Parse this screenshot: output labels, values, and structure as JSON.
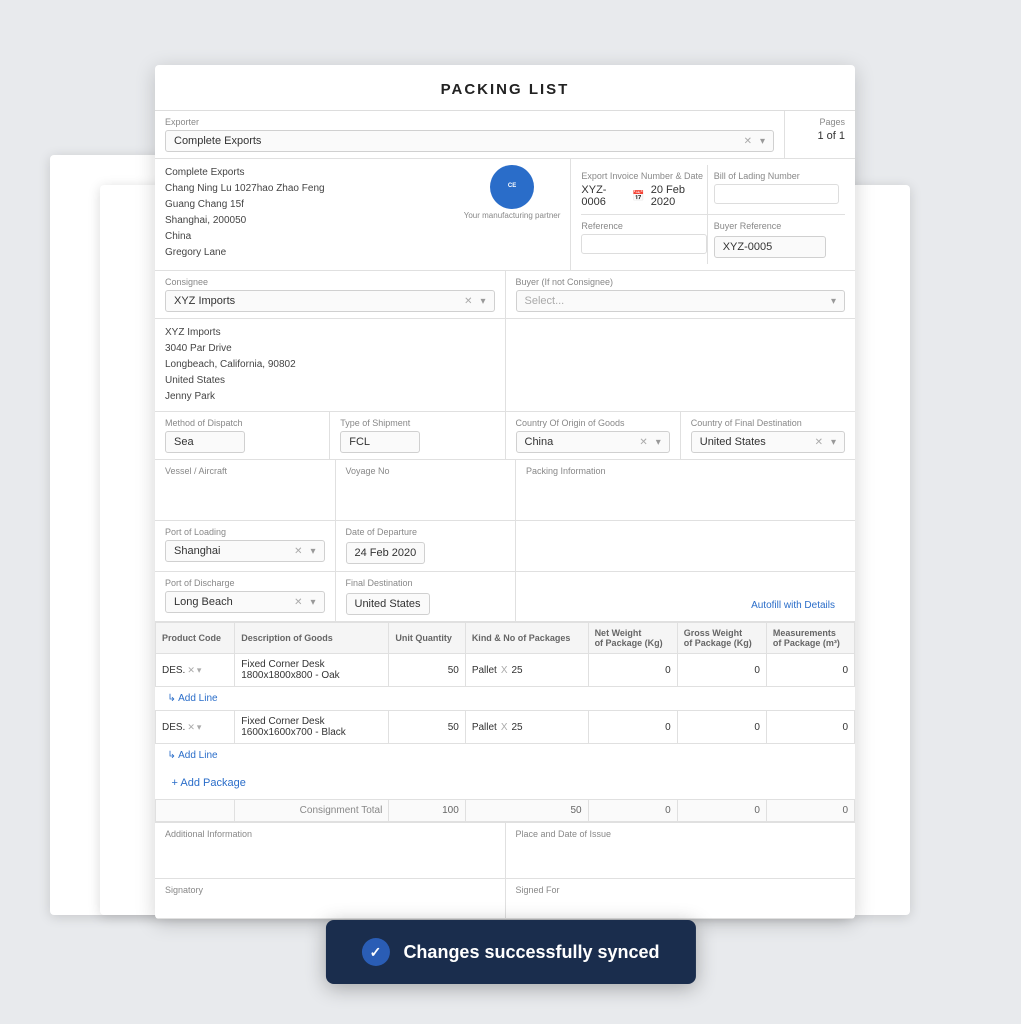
{
  "document": {
    "title": "PACKING LIST",
    "pages_label": "Pages",
    "pages_value": "1 of 1"
  },
  "exporter_section": {
    "label": "Exporter",
    "company": "Complete Exports",
    "address_line1": "Chang Ning Lu 1027hao Zhao Feng",
    "address_line2": "Guang Chang 15f",
    "address_line3": "Shanghai,  200050",
    "address_line4": "China",
    "contact": "Gregory Lane",
    "logo_text": "Complete Exports",
    "logo_tagline": "Your manufacturing partner"
  },
  "invoice_section": {
    "label": "Export Invoice Number & Date",
    "number": "XYZ-0006",
    "date": "20 Feb 2020",
    "bol_label": "Bill of Lading Number"
  },
  "reference_section": {
    "label": "Reference",
    "buyer_ref_label": "Buyer Reference",
    "buyer_ref_value": "XYZ-0005"
  },
  "consignee_section": {
    "label": "Consignee",
    "company": "XYZ Imports",
    "address_line1": "XYZ Imports",
    "address_line2": "3040  Par Drive",
    "address_line3": "Longbeach, California, 90802",
    "address_line4": "United States",
    "contact": "Jenny Park"
  },
  "buyer_section": {
    "label": "Buyer (If not Consignee)",
    "placeholder": "Select..."
  },
  "dispatch_section": {
    "method_label": "Method of Dispatch",
    "method_value": "Sea",
    "shipment_label": "Type of Shipment",
    "shipment_value": "FCL",
    "origin_label": "Country Of Origin of Goods",
    "origin_value": "China",
    "destination_label": "Country of Final Destination",
    "destination_value": "United States"
  },
  "vessel_section": {
    "vessel_label": "Vessel / Aircraft",
    "voyage_label": "Voyage No",
    "packing_label": "Packing Information"
  },
  "port_section": {
    "loading_label": "Port of Loading",
    "loading_value": "Shanghai",
    "departure_label": "Date of Departure",
    "departure_value": "24 Feb 2020",
    "discharge_label": "Port of Discharge",
    "discharge_value": "Long Beach",
    "final_label": "Final Destination",
    "final_value": "United States",
    "autofill_label": "Autofill with Details"
  },
  "table": {
    "headers": [
      "Product Code",
      "Description of Goods",
      "Unit Quantity",
      "Kind & No of Packages",
      "Net Weight of Package (Kg)",
      "Gross Weight of Package (Kg)",
      "Measurements of Package (m³)"
    ],
    "rows": [
      {
        "code": "DES.",
        "description": "Fixed Corner Desk\n1800x1800x800 - Oak",
        "quantity": "50",
        "kind": "Pallet",
        "packages": "25",
        "net_weight": "0",
        "gross_weight": "0",
        "measurements": "0"
      },
      {
        "code": "DES.",
        "description": "Fixed Corner Desk\n1600x1600x700 - Black",
        "quantity": "50",
        "kind": "Pallet",
        "packages": "25",
        "net_weight": "0",
        "gross_weight": "0",
        "measurements": "0"
      }
    ],
    "add_line_label": "↳ Add Line",
    "add_package_label": "+ Add Package",
    "consignment_total_label": "Consignment Total",
    "consignment_totals": [
      "100",
      "50",
      "0",
      "0",
      "0"
    ]
  },
  "bottom_section": {
    "additional_info_label": "Additional Information",
    "place_date_label": "Place and Date of Issue",
    "signatory_label": "Signatory",
    "signed_label": "Signed For"
  },
  "notification": {
    "message": "Changes successfully synced",
    "icon": "✓"
  }
}
